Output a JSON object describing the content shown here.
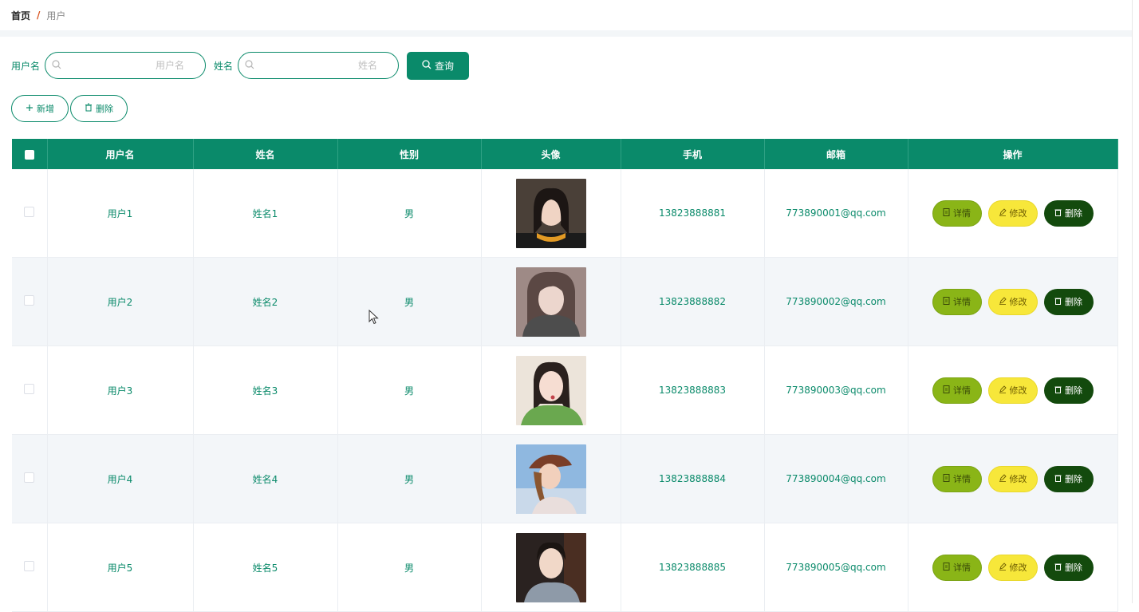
{
  "breadcrumb": {
    "home": "首页",
    "separator": "/",
    "current": "用户"
  },
  "search": {
    "username_label": "用户名",
    "username_placeholder": "用户名",
    "name_label": "姓名",
    "name_placeholder": "姓名",
    "query_label": "查询"
  },
  "actions": {
    "add_label": "新增",
    "delete_label": "删除"
  },
  "table": {
    "columns": [
      "用户名",
      "姓名",
      "性别",
      "头像",
      "手机",
      "邮箱",
      "操作"
    ],
    "op_labels": {
      "detail": "详情",
      "edit": "修改",
      "delete": "删除"
    },
    "rows": [
      {
        "username": "用户1",
        "name": "姓名1",
        "gender": "男",
        "phone": "13823888881",
        "email": "773890001@qq.com"
      },
      {
        "username": "用户2",
        "name": "姓名2",
        "gender": "男",
        "phone": "13823888882",
        "email": "773890002@qq.com"
      },
      {
        "username": "用户3",
        "name": "姓名3",
        "gender": "男",
        "phone": "13823888883",
        "email": "773890003@qq.com"
      },
      {
        "username": "用户4",
        "name": "姓名4",
        "gender": "男",
        "phone": "13823888884",
        "email": "773890004@qq.com"
      },
      {
        "username": "用户5",
        "name": "姓名5",
        "gender": "男",
        "phone": "13823888885",
        "email": "773890005@qq.com"
      }
    ]
  },
  "colors": {
    "primary": "#0a8a6a",
    "detail": "#8ab517",
    "edit": "#f7e73a",
    "delete": "#134a0d"
  },
  "icons": {
    "search": "search-icon",
    "add": "plus-icon",
    "delete": "trash-icon",
    "detail": "document-icon",
    "edit": "pencil-icon"
  }
}
